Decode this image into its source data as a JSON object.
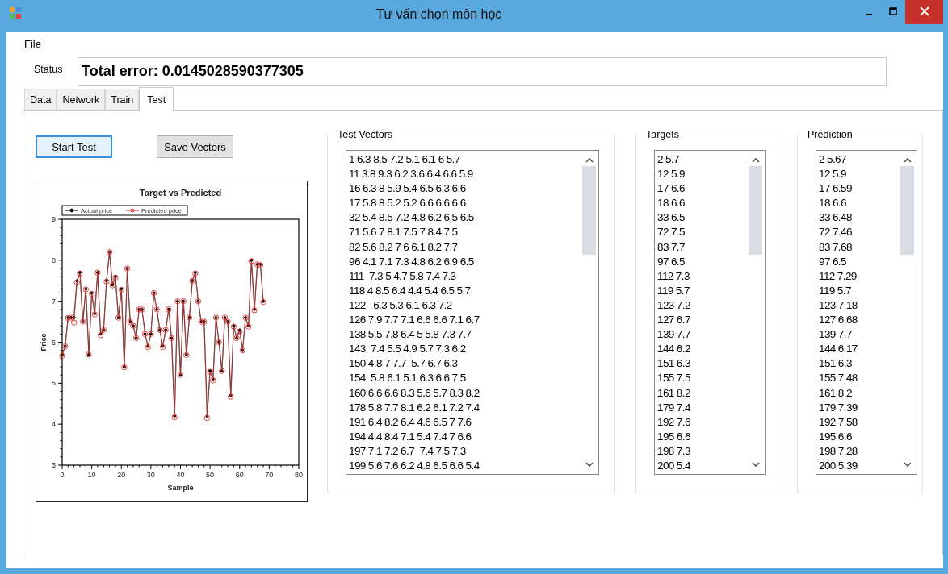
{
  "window": {
    "title": "Tư vấn chọn môn học"
  },
  "menu": [
    "File"
  ],
  "status": {
    "label": "Status",
    "value": "Total error: 0.0145028590377305"
  },
  "tabs": [
    {
      "label": "Data",
      "selected": false
    },
    {
      "label": "Network",
      "selected": false
    },
    {
      "label": "Train",
      "selected": false
    },
    {
      "label": "Test",
      "selected": true
    }
  ],
  "buttons": [
    {
      "label": "Start Test",
      "focused": true
    },
    {
      "label": "Save Vectors",
      "focused": false
    }
  ],
  "chart": {
    "chart_data": {
      "type": "line",
      "title": "Target vs Predicted",
      "xlabel": "Sample",
      "ylabel": "Price",
      "x": [
        0,
        1,
        2,
        3,
        4,
        5,
        6,
        7,
        8,
        9,
        10,
        11,
        12,
        13,
        14,
        15,
        16,
        17,
        18,
        19,
        20,
        21,
        22,
        23,
        24,
        25,
        26,
        27,
        28,
        29,
        30,
        31,
        32,
        33,
        34,
        35,
        36,
        37,
        38,
        39,
        40,
        41,
        42,
        43,
        44,
        45,
        46,
        47,
        48,
        49,
        50,
        51,
        52,
        53,
        54,
        55,
        56,
        57,
        58,
        59,
        60,
        61,
        62,
        63,
        64,
        65,
        66,
        67,
        68
      ],
      "legend": true,
      "series": [
        {
          "name": "Actual price",
          "color": "#000000",
          "marker": "filled-circle",
          "values": [
            5.7,
            5.9,
            6.6,
            6.6,
            6.6,
            7.5,
            7.7,
            6.5,
            7.3,
            5.7,
            7.2,
            6.7,
            7.7,
            6.2,
            6.3,
            7.5,
            8.2,
            7.4,
            7.6,
            6.6,
            7.3,
            5.4,
            7.8,
            6.5,
            6.4,
            6.1,
            6.8,
            6.8,
            6.2,
            5.9,
            6.2,
            7.2,
            6.8,
            6.3,
            5.9,
            6.3,
            6.8,
            6.1,
            4.2,
            7.0,
            5.2,
            7.0,
            5.7,
            6.6,
            7.5,
            7.7,
            7.0,
            6.5,
            6.5,
            4.2,
            5.3,
            5.1,
            6.6,
            6.0,
            5.3,
            6.6,
            6.5,
            4.7,
            6.4,
            6.1,
            6.3,
            5.8,
            6.6,
            6.4,
            8.0,
            6.8,
            7.9,
            7.9,
            7.0
          ]
        },
        {
          "name": "Predicted price",
          "color": "#e8302a",
          "marker": "open-circle",
          "values": [
            5.67,
            5.9,
            6.59,
            6.6,
            6.48,
            7.46,
            7.68,
            6.5,
            7.29,
            5.7,
            7.18,
            6.68,
            7.7,
            6.17,
            6.3,
            7.48,
            8.2,
            7.39,
            7.58,
            6.6,
            7.28,
            5.39,
            7.8,
            6.5,
            6.4,
            6.1,
            6.8,
            6.8,
            6.2,
            5.88,
            6.2,
            7.2,
            6.8,
            6.3,
            5.88,
            6.3,
            6.8,
            6.1,
            4.17,
            7.0,
            5.2,
            7.0,
            5.69,
            6.6,
            7.5,
            7.68,
            7.0,
            6.5,
            6.5,
            4.15,
            5.28,
            5.07,
            6.6,
            6.0,
            5.3,
            6.6,
            6.5,
            4.67,
            6.38,
            6.1,
            6.26,
            5.8,
            6.6,
            6.38,
            7.98,
            6.78,
            7.9,
            7.88,
            6.98
          ]
        }
      ],
      "xlim": [
        0,
        80
      ],
      "ylim": [
        3,
        9
      ],
      "xticks": [
        0,
        10,
        20,
        30,
        40,
        50,
        60,
        70,
        80
      ],
      "yticks": [
        3,
        4,
        5,
        6,
        7,
        8,
        9
      ]
    }
  },
  "groups": [
    {
      "title": "Test Vectors",
      "items": [
        "1 6.3 8.5 7.2 5.1 6.1 6 5.7",
        "11 3.8 9.3 6.2 3.6 6.4 6.6 5.9",
        "16 6.3 8 5.9 5.4 6.5 6.3 6.6",
        "17 5.8 8 5.2 5.2 6.6 6.6 6.6",
        "32 5.4 8.5 7.2 4.8 6.2 6.5 6.5",
        "71 5.6 7 8.1 7.5 7 8.4 7.5",
        "82 5.6 8.2 7 6 6.1 8.2 7.7",
        "96 4.1 7.1 7.3 4.8 6.2 6.9 6.5",
        "111  7.3 5 4.7 5.8 7.4 7.3",
        "118 4 8.5 6.4 4.4 5.4 6.5 5.7",
        "122   6.3 5.3 6.1 6.3 7.2",
        "126 7.9 7.7 7.1 6.6 6.6 7.1 6.7",
        "138 5.5 7.8 6.4 5 5.8 7.3 7.7",
        "143  7.4 5.5 4.9 5.7 7.3 6.2",
        "150 4.8 7 7.7  5.7 6.7 6.3",
        "154  5.8 6.1 5.1 6.3 6.6 7.5",
        "160 6.6 6.6 8.3 5.6 5.7 8.3 8.2",
        "178 5.8 7.7 8.1 6.2 6.1 7.2 7.4",
        "191 6.4 8.2 6.4 4.6 6.5 7 7.6",
        "194 4.4 8.4 7.1 5.4 7.4 7 6.6",
        "197 7.1 7.2 6.7  7.4 7.5 7.3",
        "199 5.6 7.6 6.2 4.8 6.5 6.6 5.4"
      ]
    },
    {
      "title": "Targets",
      "items": [
        "2 5.7",
        "12 5.9",
        "17 6.6",
        "18 6.6",
        "33 6.5",
        "72 7.5",
        "83 7.7",
        "97 6.5",
        "112 7.3",
        "119 5.7",
        "123 7.2",
        "127 6.7",
        "139 7.7",
        "144 6.2",
        "151 6.3",
        "155 7.5",
        "161 8.2",
        "179 7.4",
        "192 7.6",
        "195 6.6",
        "198 7.3",
        "200 5.4"
      ]
    },
    {
      "title": "Prediction",
      "items": [
        "2 5.67",
        "12 5.9",
        "17 6.59",
        "18 6.6",
        "33 6.48",
        "72 7.46",
        "83 7.68",
        "97 6.5",
        "112 7.29",
        "119 5.7",
        "123 7.18",
        "127 6.68",
        "139 7.7",
        "144 6.17",
        "151 6.3",
        "155 7.48",
        "161 8.2",
        "179 7.39",
        "192 7.58",
        "195 6.6",
        "198 7.28",
        "200 5.39"
      ]
    }
  ]
}
